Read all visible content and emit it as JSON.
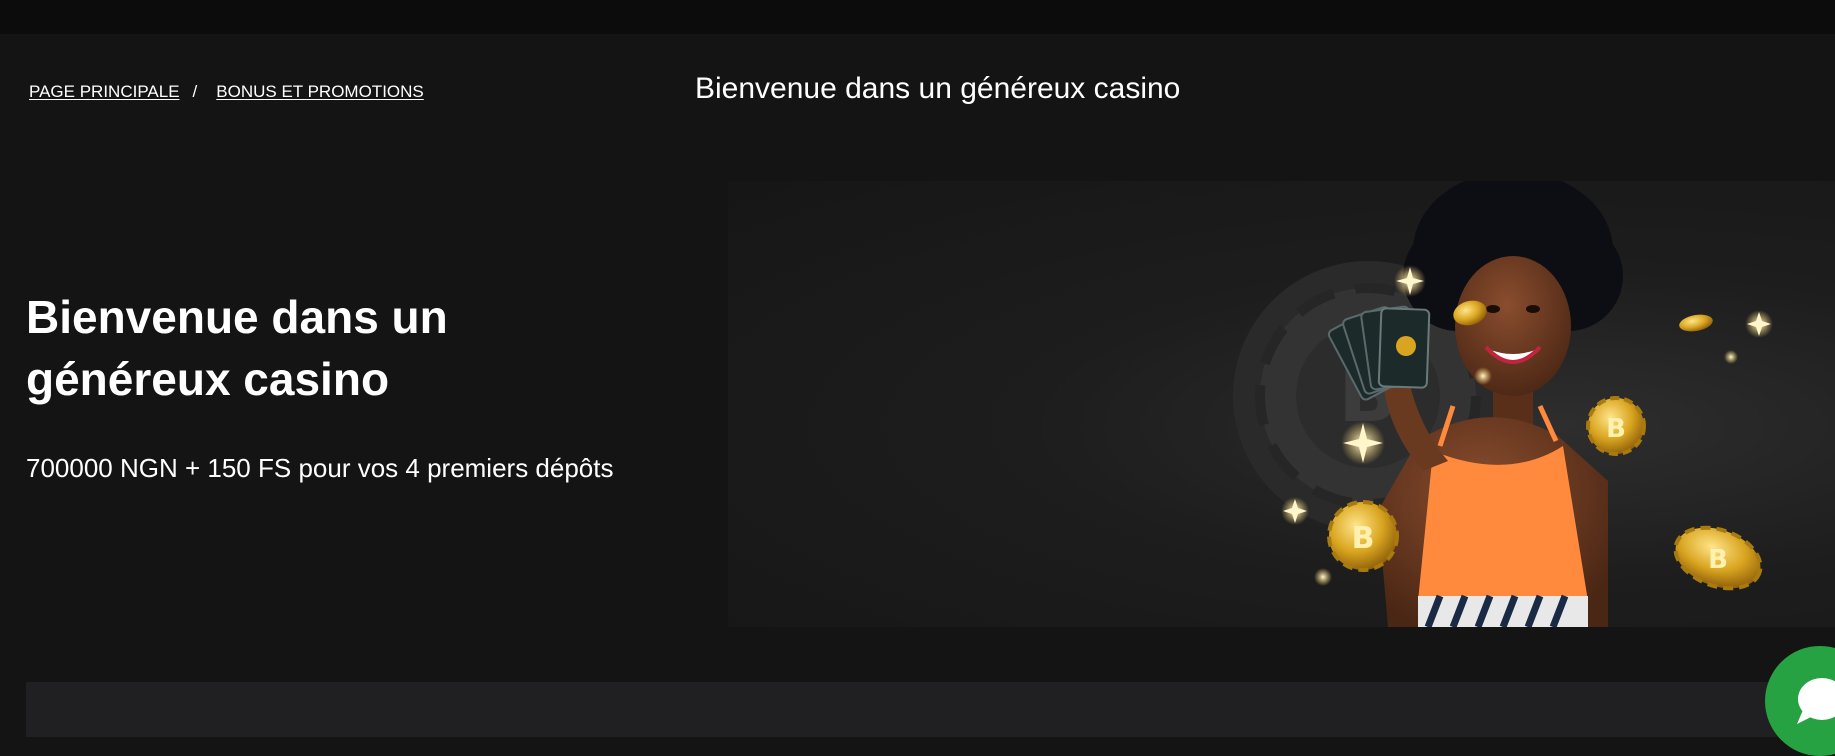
{
  "breadcrumb": {
    "home": "PAGE PRINCIPALE",
    "separator": "/",
    "current": "BONUS ET PROMOTIONS"
  },
  "page_title": "Bienvenue dans un généreux casino",
  "hero": {
    "title": "Bienvenue dans un généreux casino",
    "subtitle": "700000 NGN + 150 FS pour vos 4 premiers dépôts"
  },
  "banner": {
    "brand_mark": "B",
    "image": "woman-with-cards-and-coins-illustration"
  },
  "chat": {
    "icon": "chat-bubble-icon"
  },
  "colors": {
    "background": "#141414",
    "top_bar": "#0c0c0c",
    "panel": "#202022",
    "chat_green": "#27a243",
    "coin_gold": "#d9a520",
    "top_orange": "#ff8a3d"
  }
}
